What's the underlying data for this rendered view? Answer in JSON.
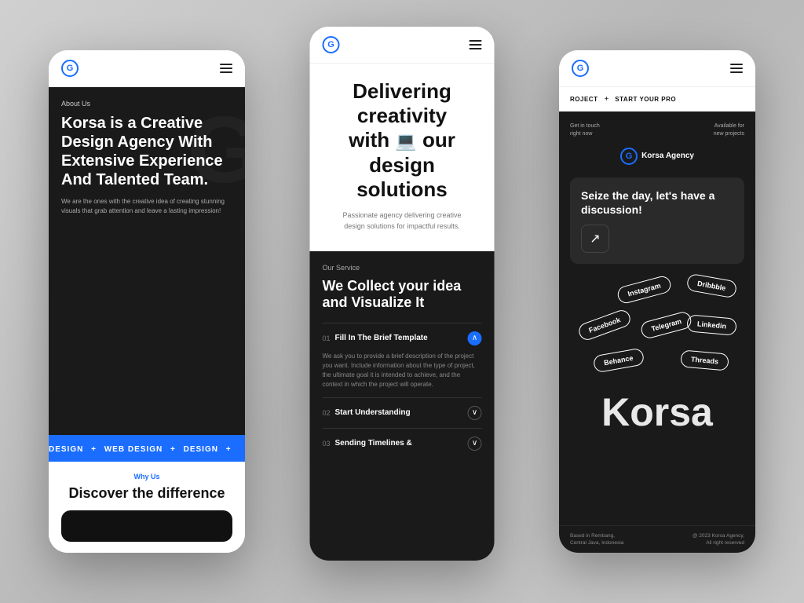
{
  "app": {
    "name": "Korsa Agency"
  },
  "phone_left": {
    "header": {
      "logo_text": "G",
      "hamburger_label": "menu"
    },
    "body": {
      "about_label": "About Us",
      "hero_title": "Korsa is a Creative Design Agency With Extensive Experience And Talented Team.",
      "hero_desc": "We are the ones with the creative idea of creating stunning visuals that grab attention and leave a lasting impression!",
      "watermark": "G",
      "marquee": "DESIGN + WEB DESIGN +"
    },
    "bottom": {
      "why_us_label": "Why Us",
      "discover_title": "Discover the difference"
    }
  },
  "phone_center": {
    "header": {
      "logo_text": "G"
    },
    "top": {
      "title_line1": "Delivering",
      "title_line2": "creativity",
      "title_line3": "with",
      "title_line4": "our",
      "title_line5": "design",
      "title_line6": "solutions",
      "description": "Passionate agency delivering creative design solutions for impactful results."
    },
    "bottom": {
      "our_service_label": "Our Service",
      "service_title": "We Collect your idea and Visualize It",
      "accordion": [
        {
          "num": "01",
          "title": "Fill In The Brief Template",
          "expanded": true,
          "content": "We ask you to provide a brief description of the project you want. Include information about the type of project, the ultimate goal it is intended to achieve, and the context in which the project will operate."
        },
        {
          "num": "02",
          "title": "Start Understanding",
          "expanded": false,
          "content": ""
        },
        {
          "num": "03",
          "title": "Sending Timelines &",
          "expanded": false,
          "content": ""
        }
      ]
    }
  },
  "phone_right": {
    "header": {
      "logo_text": "G"
    },
    "nav": {
      "items": [
        "ROJECT",
        "+",
        "START YOUR PRO"
      ]
    },
    "body": {
      "get_in_touch": "Get in touch\nright now",
      "available": "Available for\nnew projects",
      "brand_name": "Korsa Agency",
      "discussion_title": "Seize the day, let's have a discussion!",
      "arrow": "↗",
      "social_pills": [
        "Instagram",
        "Dribbble",
        "Facebook",
        "Telegram",
        "Linkedin",
        "Behance",
        "Threads"
      ],
      "korsa_big": "Korsa"
    },
    "footer": {
      "location": "Based in Rembang,\nCentral Java, Indonesia",
      "copyright": "@ 2023 Korsa Agency,\nAll right reserved"
    }
  },
  "colors": {
    "blue": "#1a6dff",
    "dark": "#1a1a1a",
    "white": "#ffffff"
  }
}
